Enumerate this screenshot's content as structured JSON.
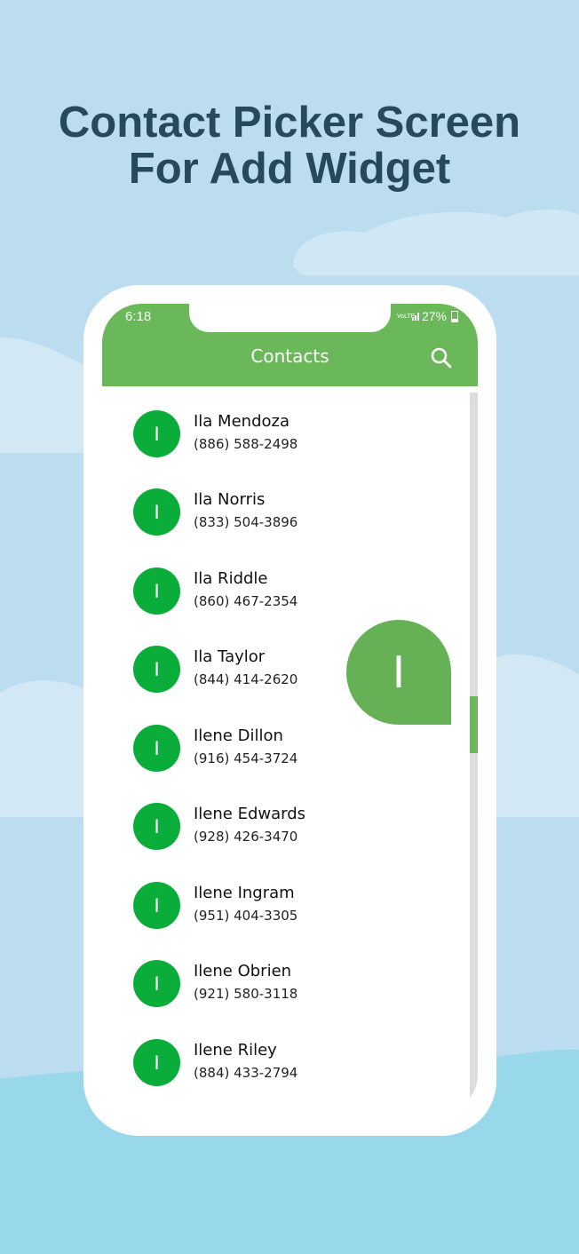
{
  "headline": {
    "line1": "Contact Picker Screen",
    "line2": "For Add Widget"
  },
  "status_bar": {
    "time": "6:18",
    "network_label": "VoLTE",
    "battery": "27%"
  },
  "app_bar": {
    "title": "Contacts"
  },
  "icons": {
    "search": "search-icon",
    "signal": "signal-icon",
    "battery": "battery-icon"
  },
  "contacts": [
    {
      "initial": "I",
      "name": "Ila Mendoza",
      "phone": "(886) 588-2498"
    },
    {
      "initial": "I",
      "name": "Ila Norris",
      "phone": "(833) 504-3896"
    },
    {
      "initial": "I",
      "name": "Ila Riddle",
      "phone": "(860) 467-2354"
    },
    {
      "initial": "I",
      "name": "Ila Taylor",
      "phone": "(844) 414-2620"
    },
    {
      "initial": "I",
      "name": "Ilene Dillon",
      "phone": "(916) 454-3724"
    },
    {
      "initial": "I",
      "name": "Ilene Edwards",
      "phone": "(928) 426-3470"
    },
    {
      "initial": "I",
      "name": "Ilene Ingram",
      "phone": "(951) 404-3305"
    },
    {
      "initial": "I",
      "name": "Ilene Obrien",
      "phone": "(921) 580-3118"
    },
    {
      "initial": "I",
      "name": "Ilene Riley",
      "phone": "(884) 433-2794"
    }
  ],
  "fast_scroll": {
    "letter": "I"
  },
  "colors": {
    "accent": "#6ab85a",
    "avatar": "#0aad3a",
    "headline": "#27495c",
    "background": "#bcdcf0"
  }
}
